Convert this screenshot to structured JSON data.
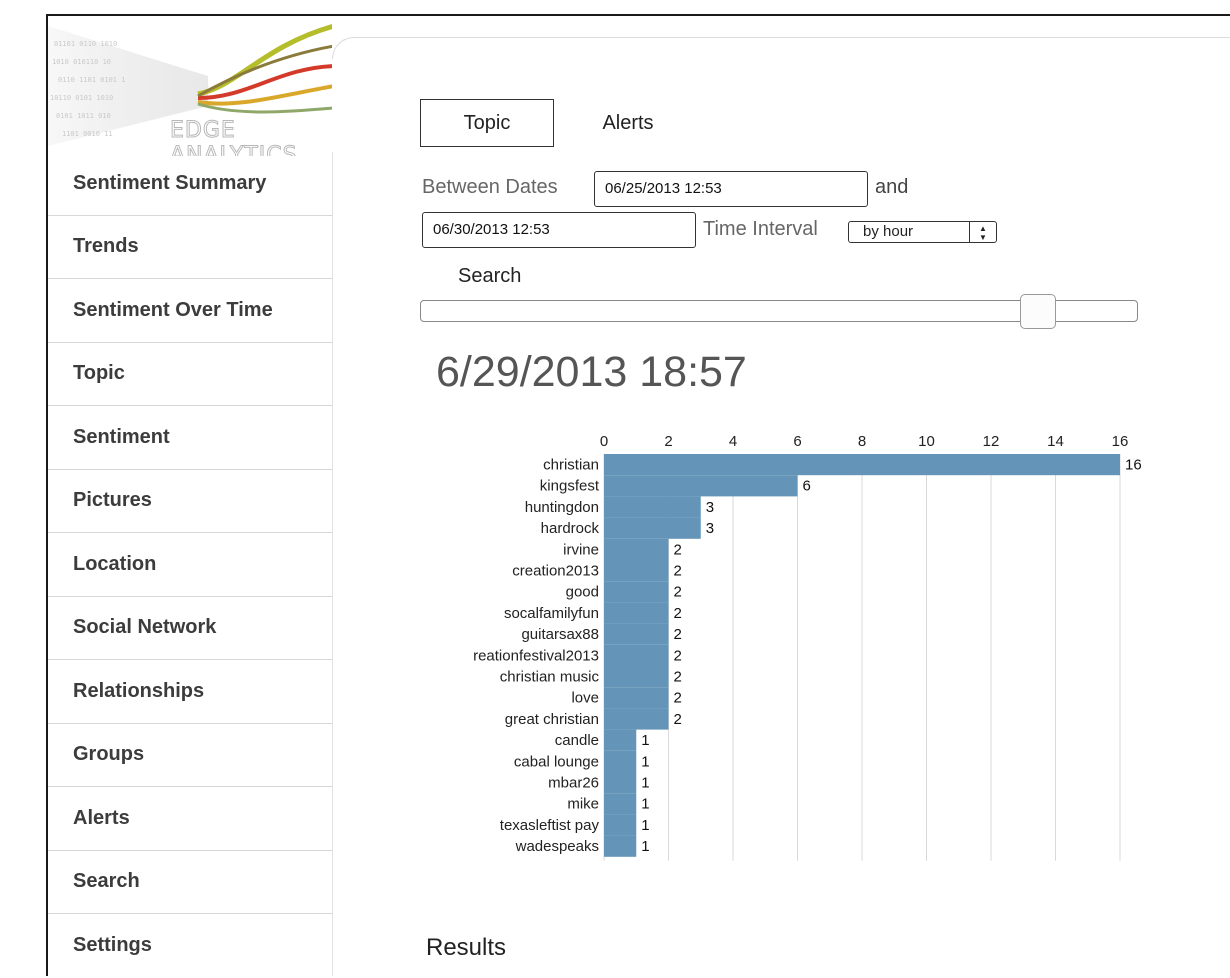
{
  "logo": {
    "text": "EDGE ANALYTICS"
  },
  "sidebar": {
    "items": [
      {
        "label": "Sentiment Summary"
      },
      {
        "label": "Trends"
      },
      {
        "label": "Sentiment Over Time"
      },
      {
        "label": "Topic"
      },
      {
        "label": "Sentiment"
      },
      {
        "label": "Pictures"
      },
      {
        "label": "Location"
      },
      {
        "label": "Social Network"
      },
      {
        "label": "Relationships"
      },
      {
        "label": "Groups"
      },
      {
        "label": "Alerts"
      },
      {
        "label": "Search"
      },
      {
        "label": "Settings"
      }
    ]
  },
  "tabs": {
    "topic": "Topic",
    "alerts": "Alerts"
  },
  "filters": {
    "between_label": "Between Dates",
    "start_value": "06/25/2013 12:53",
    "and_label": "and",
    "end_value": "06/30/2013 12:53",
    "interval_label": "Time Interval",
    "interval_value": "by hour",
    "search_label": "Search"
  },
  "slider": {
    "value": 0.88
  },
  "current_time": "6/29/2013 18:57",
  "results_heading": "Results",
  "colors": {
    "bar": "#6495b8",
    "grid": "#d9d9d9"
  },
  "chart_data": {
    "type": "bar",
    "orientation": "horizontal",
    "categories": [
      "christian",
      "kingsfest",
      "huntingdon",
      "hardrock",
      "irvine",
      "creation2013",
      "good",
      "socalfamilyfun",
      "guitarsax88",
      "reationfestival2013",
      "christian music",
      "love",
      "great christian",
      "candle",
      "cabal lounge",
      "mbar26",
      "mike",
      "texasleftist pay",
      "wadespeaks"
    ],
    "values": [
      16,
      6,
      3,
      3,
      2,
      2,
      2,
      2,
      2,
      2,
      2,
      2,
      2,
      1,
      1,
      1,
      1,
      1,
      1
    ],
    "xlim": [
      0,
      16
    ],
    "xticks": [
      0,
      2,
      4,
      6,
      8,
      10,
      12,
      14,
      16
    ],
    "axis_position": "top",
    "grid": true,
    "data_labels": true
  }
}
